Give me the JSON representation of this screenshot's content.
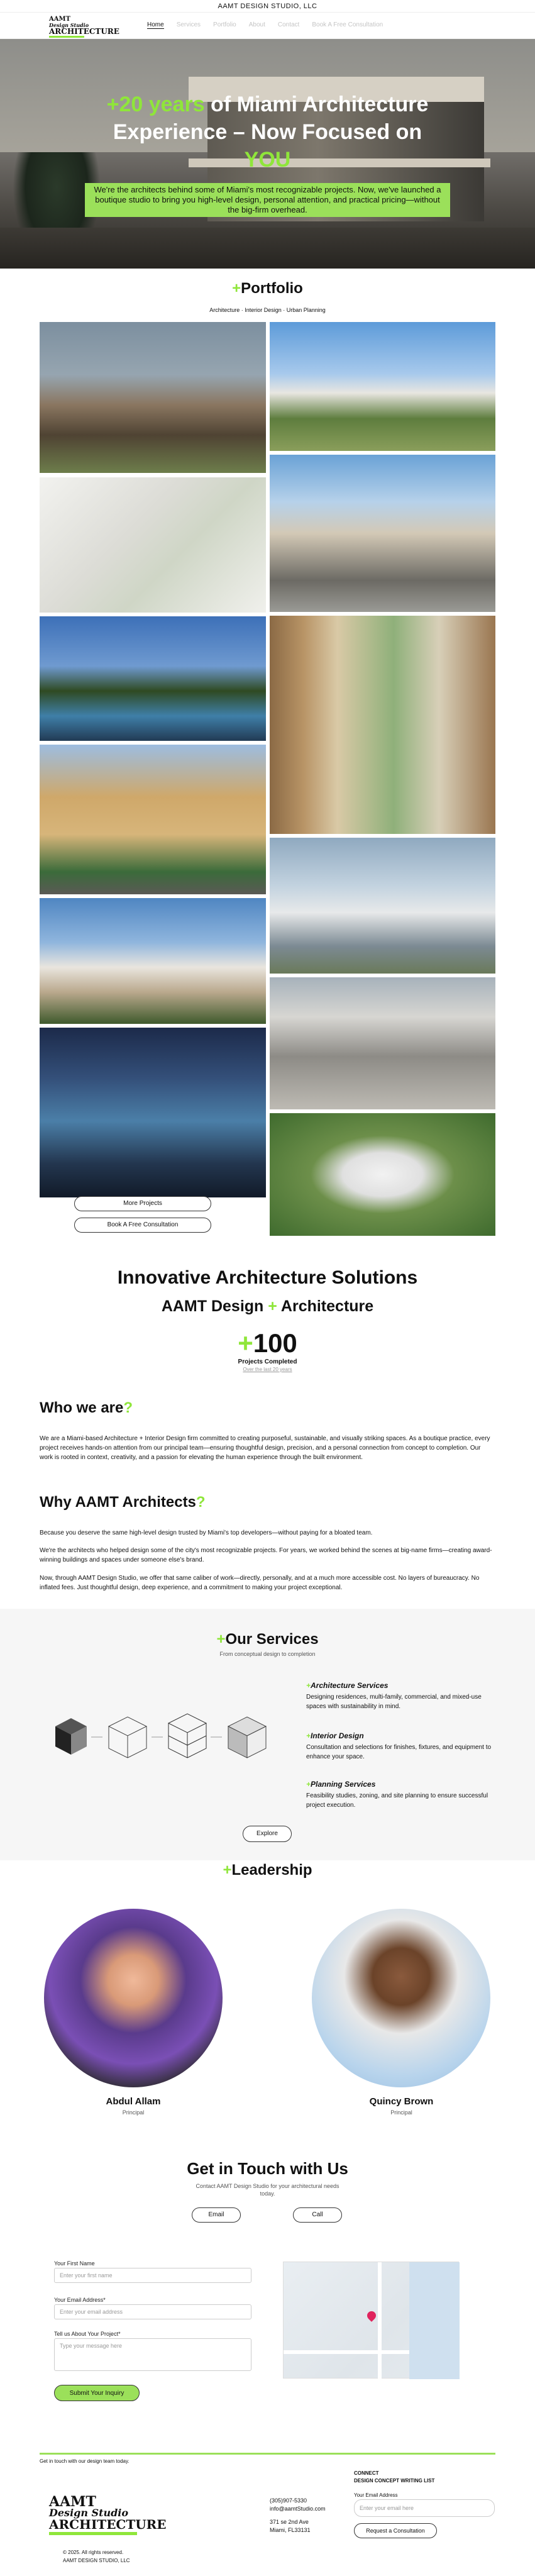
{
  "topbar": {
    "text": "AAMT DESIGN STUDIO, LLC"
  },
  "logo": {
    "line1": "AAMT",
    "line2": "Design Studio",
    "line3": "ARCHITECTURE"
  },
  "nav": {
    "items": [
      "Home",
      "Services",
      "Portfolio",
      "About",
      "Contact",
      "Book A Free Consultation"
    ]
  },
  "hero": {
    "title_highlight": "+20 years",
    "title_rest": "of Miami Architecture Experience – Now Focused on",
    "title_you": "YOU",
    "subtitle": "We're the architects behind some of Miami's most recognizable projects. Now, we've launched a boutique studio to bring you high-level design, personal attention, and practical pricing—without the big-firm overhead."
  },
  "portfolio": {
    "plus": "+",
    "title": "Portfolio",
    "categories": "Architecture  ·  Interior Design  ·  Urban Planning",
    "more_button": "More Projects",
    "consult_button": "Book A Free Consultation"
  },
  "solutions": {
    "title": "Innovative Architecture Solutions",
    "sub_a": "AAMT Design",
    "sub_plus": "+",
    "sub_b": "Architecture",
    "stat_plus": "+",
    "stat_value": "100",
    "stat_label": "Projects Completed",
    "stat_note": "Over the last 20 years"
  },
  "who": {
    "title": "Who we are",
    "q": "?",
    "body": "We are a Miami-based Architecture + Interior Design firm committed to creating purposeful, sustainable, and visually striking spaces. As a boutique practice, every project receives hands-on attention from our principal team—ensuring thoughtful design, precision, and a personal connection from concept to completion. Our work is rooted in context, creativity, and a passion for elevating the human experience through the built environment."
  },
  "why": {
    "title": "Why AAMT Architects",
    "q": "?",
    "p1": "Because you deserve the same high-level design trusted by Miami's top developers—without paying for a bloated team.",
    "p2": "We're the architects who helped design some of the city's most recognizable projects. For years, we worked behind the scenes at big-name firms—creating award-winning buildings and spaces under someone else's brand.",
    "p3": "Now, through AAMT Design Studio, we offer that same caliber of work—directly, personally, and at a much more accessible cost. No layers of bureaucracy. No inflated fees. Just thoughtful design, deep experience, and a commitment to making your project exceptional."
  },
  "services": {
    "plus": "+",
    "title": "Our Services",
    "subtitle": "From conceptual design to completion",
    "items": [
      {
        "plus": "+",
        "title": "Architecture Services",
        "desc": "Designing residences, multi-family, commercial, and mixed-use spaces with sustainability in mind."
      },
      {
        "plus": "+",
        "title": "Interior Design",
        "desc": "Consultation and selections for finishes, fixtures, and equipment to enhance your space."
      },
      {
        "plus": "+",
        "title": "Planning Services",
        "desc": "Feasibility studies, zoning, and site planning to ensure successful project execution."
      }
    ],
    "explore_button": "Explore"
  },
  "leadership": {
    "plus": "+",
    "title": "Leadership",
    "people": [
      {
        "name": "Abdul Allam",
        "role": "Principal"
      },
      {
        "name": "Quincy Brown",
        "role": "Principal"
      }
    ]
  },
  "contact": {
    "title": "Get in Touch with Us",
    "subtitle": "Contact AAMT Design Studio for your architectural needs today.",
    "email_button": "Email",
    "call_button": "Call",
    "name_label": "Your First Name",
    "name_placeholder": "Enter your first name",
    "email_label": "Your Email Address*",
    "email_placeholder": "Enter your email address",
    "project_label": "Tell us About Your Project*",
    "project_placeholder": "Type your message here",
    "submit_button": "Submit Your Inquiry"
  },
  "footer": {
    "tagline": "Get in touch with our design team today.",
    "copyright": "© 2025. All rights reserved.",
    "company": "AAMT DESIGN STUDIO, LLC",
    "phone": "(305)907-5330",
    "email": "info@aamtStudio.com",
    "address1": "371 se 2nd Ave",
    "address2": "Miami, FL33131",
    "connect_title": "CONNECT",
    "mailing_title": "DESIGN CONCEPT WRITING LIST",
    "mailing_label": "Your Email Address",
    "mailing_placeholder": "Enter your email here",
    "consult_button": "Request a Consultation"
  },
  "colors": {
    "accent": "#8fe63a",
    "hero_sub_bg": "#9be05a"
  }
}
